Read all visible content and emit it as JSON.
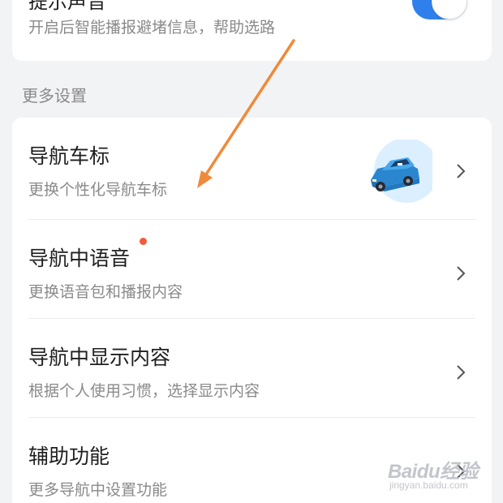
{
  "top_card": {
    "title": "提示声音",
    "subtitle": "开启后智能播报避堵信息，帮助选路",
    "toggle_on": true
  },
  "section": {
    "header": "更多设置"
  },
  "rows": [
    {
      "title": "导航车标",
      "subtitle": "更换个性化导航车标",
      "icon": "blue-car-icon",
      "chevron": "chevron-right-icon"
    },
    {
      "title": "导航中语音",
      "subtitle": "更换语音包和播报内容",
      "badge": "red-dot",
      "chevron": "chevron-right-icon"
    },
    {
      "title": "导航中显示内容",
      "subtitle": "根据个人使用习惯，选择显示内容",
      "chevron": "chevron-right-icon"
    },
    {
      "title": "辅助功能",
      "subtitle": "更多导航中设置功能",
      "chevron": "chevron-right-icon"
    }
  ],
  "colors": {
    "background": "#f2f3f5",
    "card": "#ffffff",
    "toggle": "#2f80ed",
    "badge": "#f25a3c",
    "annotation_arrow": "#ef8a3a",
    "car_body": "#3a9ee6"
  },
  "watermark": {
    "brand": "Baidu经验",
    "url": "jingyan.baidu.com"
  }
}
